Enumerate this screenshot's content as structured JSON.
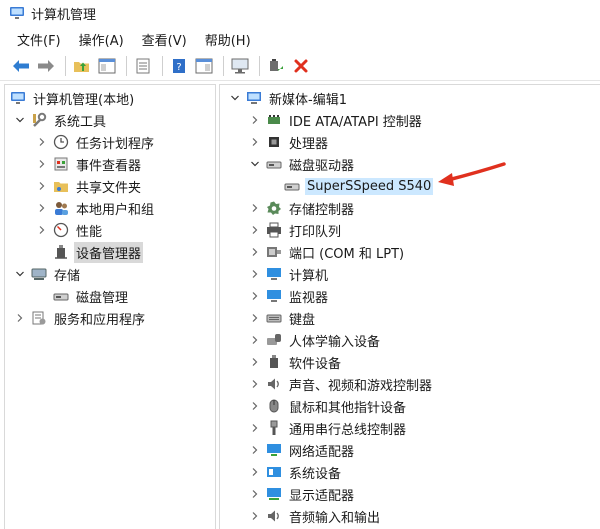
{
  "window": {
    "title": "计算机管理"
  },
  "menu": {
    "items": [
      "文件(F)",
      "操作(A)",
      "查看(V)",
      "帮助(H)"
    ]
  },
  "left_tree": {
    "root": "计算机管理(本地)",
    "items": [
      "系统工具",
      "任务计划程序",
      "事件查看器",
      "共享文件夹",
      "本地用户和组",
      "性能",
      "设备管理器",
      "存储",
      "磁盘管理",
      "服务和应用程序"
    ]
  },
  "right_tree": {
    "root": "新媒体-编辑1",
    "items": [
      "IDE ATA/ATAPI 控制器",
      "处理器",
      "磁盘驱动器",
      "SuperSSpeed S540",
      "存储控制器",
      "打印队列",
      "端口 (COM 和 LPT)",
      "计算机",
      "监视器",
      "键盘",
      "人体学输入设备",
      "软件设备",
      "声音、视频和游戏控制器",
      "鼠标和其他指针设备",
      "通用串行总线控制器",
      "网络适配器",
      "系统设备",
      "显示适配器",
      "音频输入和输出"
    ]
  },
  "colors": {
    "accent": "#e0301e",
    "selected_bg": "#cce8ff",
    "toolbar_blue": "#2f7dd1"
  }
}
